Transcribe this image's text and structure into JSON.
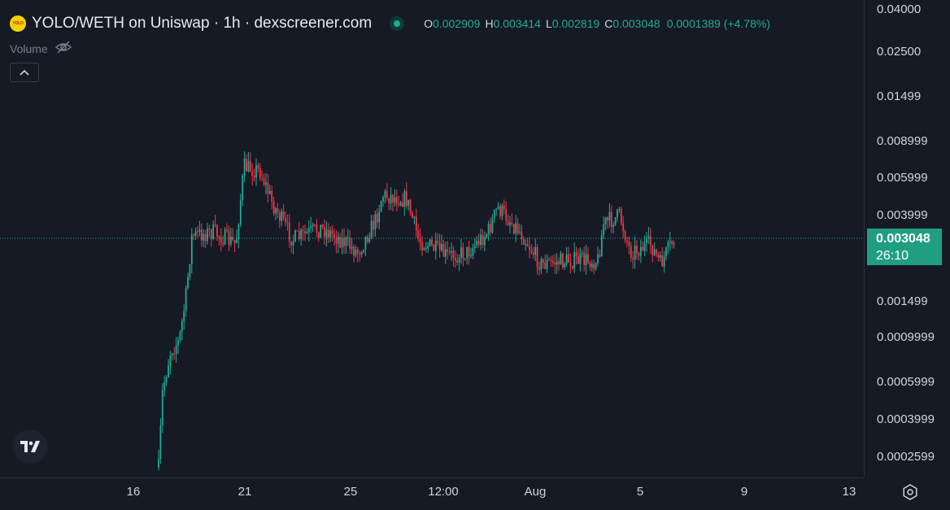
{
  "header": {
    "logo_text": "YOLO",
    "title": "YOLO/WETH on Uniswap · 1h · dexscreener.com",
    "ohlc": {
      "o_label": "O",
      "o_value": "0.002909",
      "h_label": "H",
      "h_value": "0.003414",
      "l_label": "L",
      "l_value": "0.002819",
      "c_label": "C",
      "c_value": "0.003048",
      "change": "0.0001389 (+4.78%)"
    }
  },
  "volume": {
    "label": "Volume",
    "icon": "eye-crossed-icon"
  },
  "price_axis": {
    "labels": [
      "0.04000",
      "0.02500",
      "0.01499",
      "0.008999",
      "0.005999",
      "0.003999",
      "0.001499",
      "0.0009999",
      "0.0005999",
      "0.0003999",
      "0.0002599"
    ],
    "current_price": "0.003048",
    "countdown": "26:10"
  },
  "time_axis": {
    "labels": [
      "16",
      "21",
      "25",
      "12:00",
      "Aug",
      "5",
      "9",
      "13"
    ]
  },
  "colors": {
    "up": "#22ab94",
    "down": "#f23645",
    "background": "#161a25",
    "current_price_bg": "#1f9e82"
  }
}
